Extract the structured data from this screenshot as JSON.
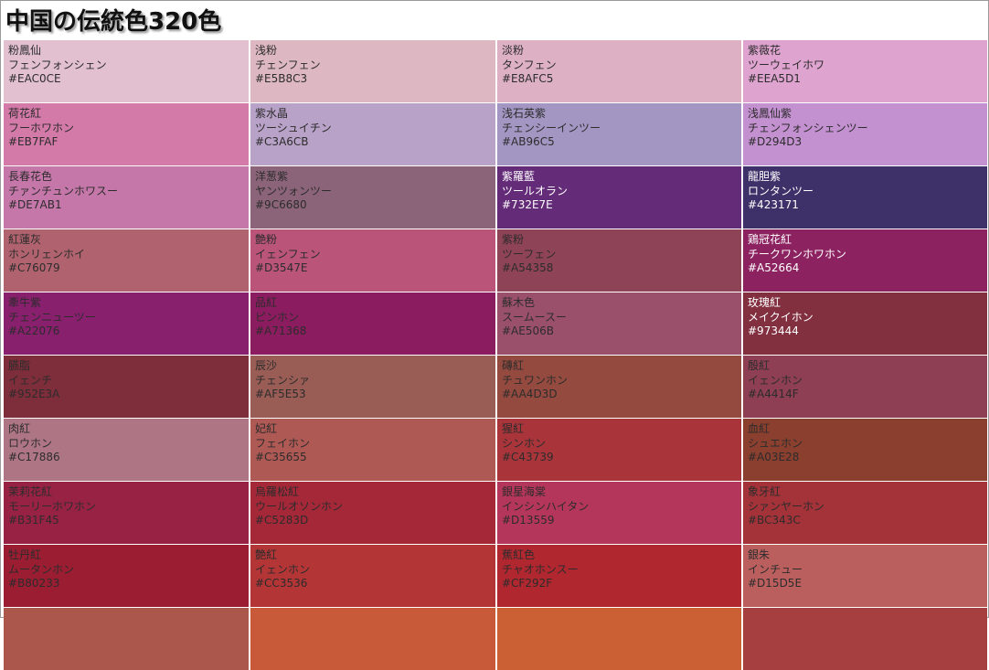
{
  "title": "中国の伝統色320色",
  "colors": [
    {
      "name": "粉鳳仙",
      "reading": "フェンフォンシェン",
      "hex": "#EAC0CE",
      "swatch": "#E2C0D0",
      "light": false
    },
    {
      "name": "浅粉",
      "reading": "チェンフェン",
      "hex": "#E5B8C3",
      "swatch": "#DDB8C3",
      "light": false
    },
    {
      "name": "淡粉",
      "reading": "タンフェン",
      "hex": "#E8AFC5",
      "swatch": "#DDB0C3",
      "light": false
    },
    {
      "name": "紫薇花",
      "reading": "ツーウェイホワ",
      "hex": "#EEA5D1",
      "swatch": "#DFA3D0",
      "light": false
    },
    {
      "name": "荷花紅",
      "reading": "フーホワホン",
      "hex": "#EB7FAF",
      "swatch": "#D37AA8",
      "light": false
    },
    {
      "name": "紫水晶",
      "reading": "ツーシュイチン",
      "hex": "#C3A6CB",
      "swatch": "#B9A2C8",
      "light": false
    },
    {
      "name": "浅石英紫",
      "reading": "チェンシーインツー",
      "hex": "#AB96C5",
      "swatch": "#A496C3",
      "light": false
    },
    {
      "name": "浅鳳仙紫",
      "reading": "チェンフォンシェンツー",
      "hex": "#D294D3",
      "swatch": "#C390D0",
      "light": false
    },
    {
      "name": "長春花色",
      "reading": "チァンチュンホワスー",
      "hex": "#DE7AB1",
      "swatch": "#C677AA",
      "light": false
    },
    {
      "name": "洋葱紫",
      "reading": "ヤンツォンツー",
      "hex": "#9C6680",
      "swatch": "#8B6479",
      "light": false
    },
    {
      "name": "紫羅藍",
      "reading": "ツールオラン",
      "hex": "#732E7E",
      "swatch": "#642B78",
      "light": true
    },
    {
      "name": "龍胆紫",
      "reading": "ロンタンツー",
      "hex": "#423171",
      "swatch": "#3E3169",
      "light": true
    },
    {
      "name": "紅蓮灰",
      "reading": "ホンリェンホイ",
      "hex": "#C76079",
      "swatch": "#B0636F",
      "light": false
    },
    {
      "name": "艶粉",
      "reading": "イェンフェン",
      "hex": "#D3547E",
      "swatch": "#BA5479",
      "light": false
    },
    {
      "name": "紫粉",
      "reading": "ツーフェン",
      "hex": "#A54358",
      "swatch": "#8F4356",
      "light": false
    },
    {
      "name": "鶏冠花紅",
      "reading": "チークワンホワホン",
      "hex": "#A52664",
      "swatch": "#8C2260",
      "light": true
    },
    {
      "name": "牽牛紫",
      "reading": "チェンニューツー",
      "hex": "#A22076",
      "swatch": "#88206E",
      "light": false
    },
    {
      "name": "品紅",
      "reading": "ピンホン",
      "hex": "#A71368",
      "swatch": "#8C1C60",
      "light": false
    },
    {
      "name": "蘇木色",
      "reading": "スームースー",
      "hex": "#AE506B",
      "swatch": "#9A506A",
      "light": false
    },
    {
      "name": "玫瑰紅",
      "reading": "メイクイホン",
      "hex": "#973444",
      "swatch": "#822F40",
      "light": true
    },
    {
      "name": "臙脂",
      "reading": "イェンチ",
      "hex": "#952E3A",
      "swatch": "#7E2D3A",
      "light": false
    },
    {
      "name": "辰沙",
      "reading": "チェンシァ",
      "hex": "#AF5E53",
      "swatch": "#9A5D55",
      "light": false
    },
    {
      "name": "磚紅",
      "reading": "チュワンホン",
      "hex": "#AA4D3D",
      "swatch": "#944A3E",
      "light": false
    },
    {
      "name": "殷紅",
      "reading": "イェンホン",
      "hex": "#A4414F",
      "swatch": "#8E3F53",
      "light": false
    },
    {
      "name": "肉紅",
      "reading": "ロウホン",
      "hex": "#C17886",
      "swatch": "#AE7685",
      "light": false
    },
    {
      "name": "妃紅",
      "reading": "フェイホン",
      "hex": "#C35655",
      "swatch": "#AF5955",
      "light": false
    },
    {
      "name": "猩紅",
      "reading": "シンホン",
      "hex": "#C43739",
      "swatch": "#A9353B",
      "light": false
    },
    {
      "name": "血紅",
      "reading": "シュエホン",
      "hex": "#A03E28",
      "swatch": "#8B3F2E",
      "light": false
    },
    {
      "name": "茉莉花紅",
      "reading": "モーリーホワホン",
      "hex": "#B31F45",
      "swatch": "#982244",
      "light": false
    },
    {
      "name": "烏羅松紅",
      "reading": "ウールオソンホン",
      "hex": "#C5283D",
      "swatch": "#A52838",
      "light": false
    },
    {
      "name": "銀星海棠",
      "reading": "インシンハイタン",
      "hex": "#D13559",
      "swatch": "#B4365A",
      "light": false
    },
    {
      "name": "象牙紅",
      "reading": "シァンヤーホン",
      "hex": "#BC343C",
      "swatch": "#A43339",
      "light": false
    },
    {
      "name": "牡丹紅",
      "reading": "ムータンホン",
      "hex": "#B80233",
      "swatch": "#9B1D32",
      "light": false
    },
    {
      "name": "艶紅",
      "reading": "イェンホン",
      "hex": "#CC3536",
      "swatch": "#B33536",
      "light": false
    },
    {
      "name": "蕉紅色",
      "reading": "チャオホンスー",
      "hex": "#CF292F",
      "swatch": "#B0272F",
      "light": false
    },
    {
      "name": "銀朱",
      "reading": "インチュー",
      "hex": "#D15D5E",
      "swatch": "#BB5F5E",
      "light": false
    }
  ],
  "partial_row_swatches": [
    "#AC574C",
    "#C85A3A",
    "#CB6035",
    "#A64040"
  ],
  "edge_swatches": [
    "#C890C8",
    "#B98FD0",
    "#7A4C86",
    "#8C4E8A",
    "#9A2A70",
    "#8E2C4C",
    "#9C3A3C",
    "#A02E40",
    "#A83040",
    "#A83A40"
  ]
}
